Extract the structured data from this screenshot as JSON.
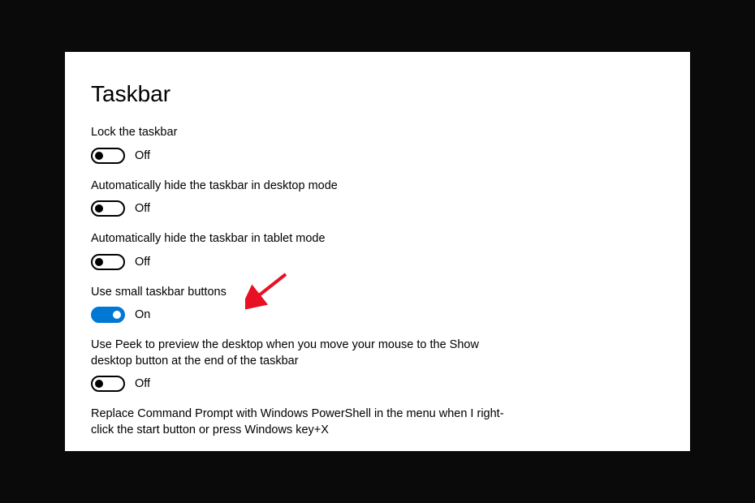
{
  "page": {
    "title": "Taskbar"
  },
  "settings": [
    {
      "label": "Lock the taskbar",
      "state": "Off",
      "on": false,
      "name": "lock-taskbar"
    },
    {
      "label": "Automatically hide the taskbar in desktop mode",
      "state": "Off",
      "on": false,
      "name": "auto-hide-desktop"
    },
    {
      "label": "Automatically hide the taskbar in tablet mode",
      "state": "Off",
      "on": false,
      "name": "auto-hide-tablet"
    },
    {
      "label": "Use small taskbar buttons",
      "state": "On",
      "on": true,
      "name": "small-taskbar-buttons"
    },
    {
      "label": "Use Peek to preview the desktop when you move your mouse to the Show desktop button at the end of the taskbar",
      "state": "Off",
      "on": false,
      "name": "use-peek"
    },
    {
      "label": "Replace Command Prompt with Windows PowerShell in the menu when I right-click the start button or press Windows key+X",
      "state": "",
      "on": null,
      "name": "replace-cmd-powershell"
    }
  ],
  "annotation": {
    "arrow_color": "#e81123"
  }
}
